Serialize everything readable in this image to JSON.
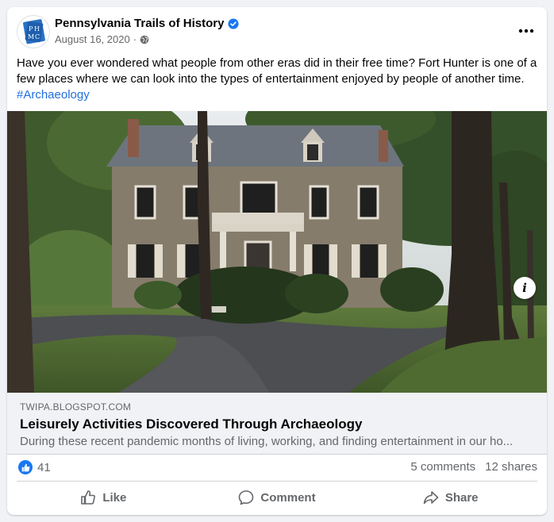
{
  "post": {
    "page_name": "Pennsylvania Trails of History",
    "date": "August 16, 2020",
    "separator": "·",
    "avatar_text": "PHMC",
    "text": "Have you ever wondered what people from other eras did in their free time? Fort Hunter is one of a few places where we can look into the types of entertainment enjoyed by people of another time.",
    "hashtag": "#Archaeology",
    "info_label": "i"
  },
  "link_preview": {
    "domain": "TWIPA.BLOGSPOT.COM",
    "title": "Leisurely Activities Discovered Through Archaeology",
    "description": "During these recent pandemic months of living, working, and finding entertainment in our ho..."
  },
  "stats": {
    "reactions": "41",
    "comments": "5 comments",
    "shares": "12 shares"
  },
  "actions": {
    "like": "Like",
    "comment": "Comment",
    "share": "Share"
  },
  "colors": {
    "accent": "#1877f2",
    "hashtag": "#216fdb",
    "secondary_text": "#65676b"
  },
  "icons": {
    "verified": "verified-badge-icon",
    "globe": "globe-icon",
    "more": "more-options-icon",
    "like_reaction": "thumbs-up-reaction-icon",
    "like": "thumbs-up-icon",
    "comment": "comment-bubble-icon",
    "share": "share-arrow-icon",
    "info": "info-icon"
  }
}
